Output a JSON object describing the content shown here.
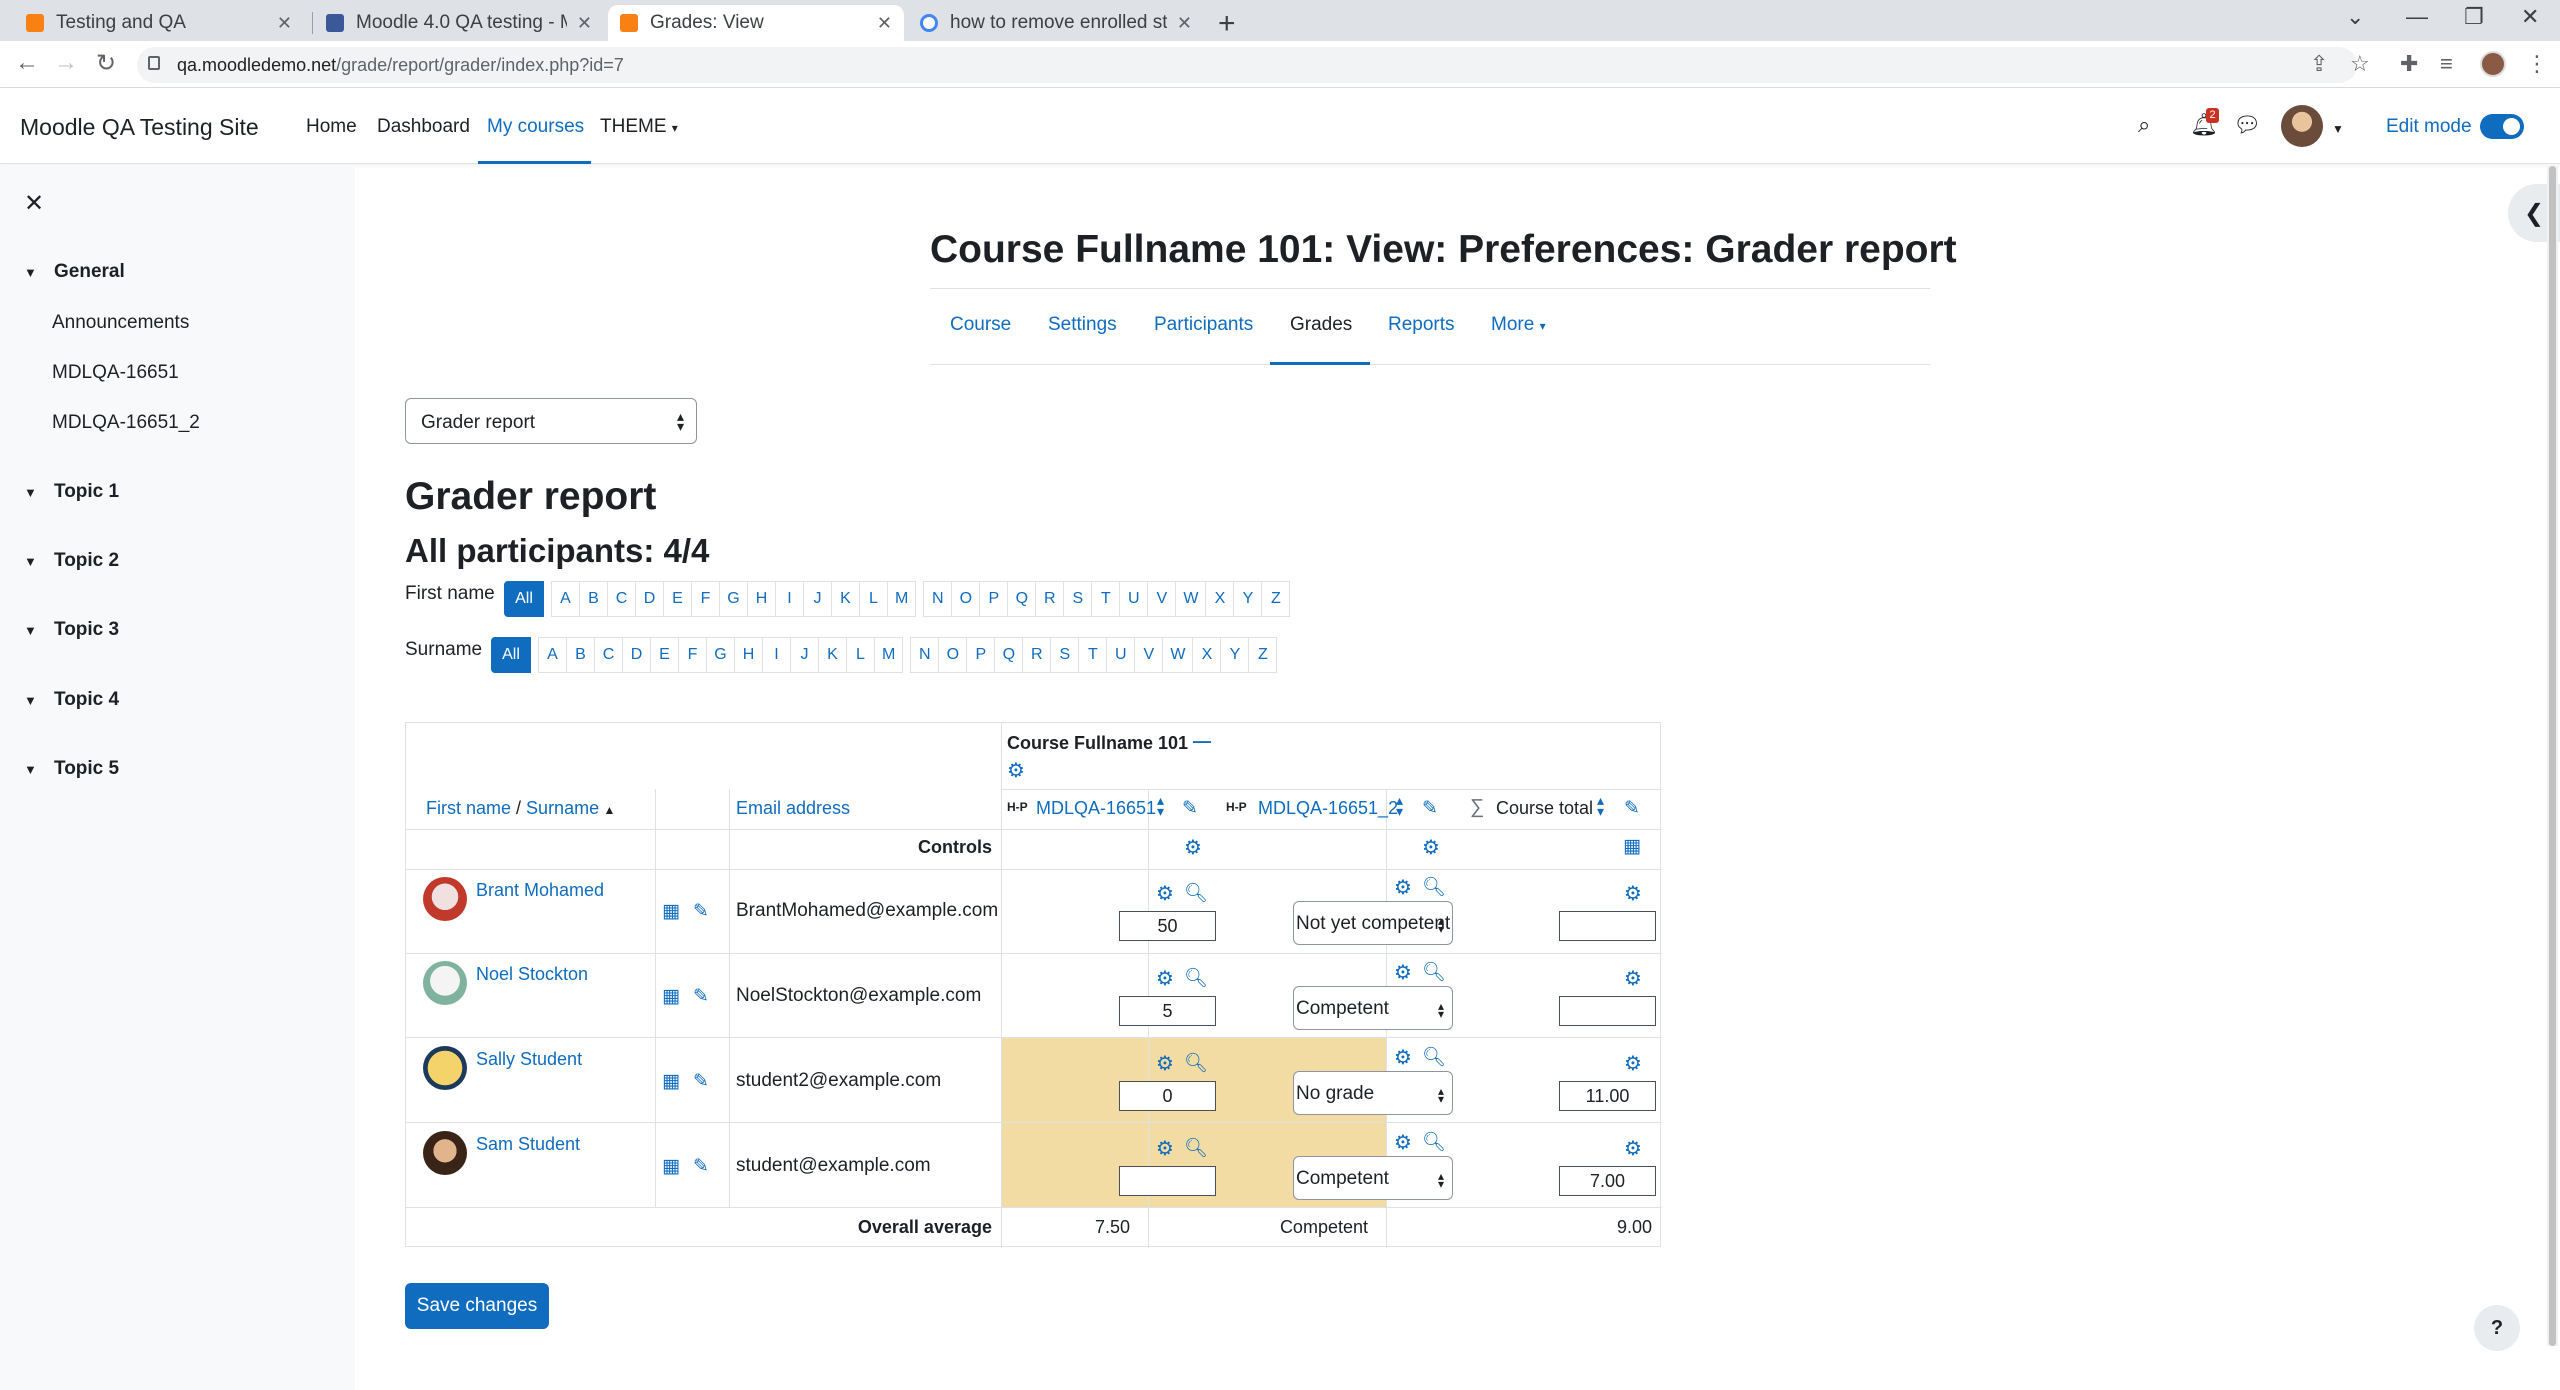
{
  "browser": {
    "tabs": [
      {
        "title": "Testing and QA",
        "color": "#f98012"
      },
      {
        "title": "Moodle 4.0 QA testing - Moodle",
        "color": "#3b5998"
      },
      {
        "title": "Grades: View",
        "color": "#f98012"
      },
      {
        "title": "how to remove enrolled students",
        "color": "#4285f4"
      }
    ],
    "url_host": "qa.moodledemo.net",
    "url_path": "/grade/report/grader/index.php?id=7"
  },
  "navbar": {
    "site_name": "Moodle QA Testing Site",
    "links": [
      "Home",
      "Dashboard",
      "My courses",
      "THEME"
    ],
    "notification_count": "2",
    "edit_mode_label": "Edit mode"
  },
  "drawer": {
    "sections": [
      {
        "title": "General",
        "items": [
          "Announcements",
          "MDLQA-16651",
          "MDLQA-16651_2"
        ]
      },
      {
        "title": "Topic 1"
      },
      {
        "title": "Topic 2"
      },
      {
        "title": "Topic 3"
      },
      {
        "title": "Topic 4"
      },
      {
        "title": "Topic 5"
      }
    ]
  },
  "page": {
    "title": "Course Fullname 101: View: Preferences: Grader report",
    "secondary_nav": [
      "Course",
      "Settings",
      "Participants",
      "Grades",
      "Reports",
      "More"
    ],
    "report_select": "Grader report",
    "heading": "Grader report",
    "participants": "All participants: 4/4"
  },
  "initials": {
    "firstname_label": "First name",
    "surname_label": "Surname",
    "all_label": "All",
    "letters": [
      "A",
      "B",
      "C",
      "D",
      "E",
      "F",
      "G",
      "H",
      "I",
      "J",
      "K",
      "L",
      "M",
      "N",
      "O",
      "P",
      "Q",
      "R",
      "S",
      "T",
      "U",
      "V",
      "W",
      "X",
      "Y",
      "Z"
    ]
  },
  "grader": {
    "course_name": "Course Fullname 101",
    "col_firstname": "First name",
    "col_sep": " / ",
    "col_surname": "Surname",
    "col_email": "Email address",
    "items": [
      "MDLQA-16651",
      "MDLQA-16651_2",
      "Course total"
    ],
    "item_icons": [
      "H-P",
      "H-P",
      "∑"
    ],
    "controls_label": "Controls",
    "rows": [
      {
        "name": "Brant Mohamed",
        "email": "BrantMohamed@example.com",
        "grade1": "50",
        "grade2": "Not yet competent",
        "total": "",
        "overridden": false
      },
      {
        "name": "Noel Stockton",
        "email": "NoelStockton@example.com",
        "grade1": "5",
        "grade2": "Competent",
        "total": "",
        "overridden": false
      },
      {
        "name": "Sally Student",
        "email": "student2@example.com",
        "grade1": "0",
        "grade2": "No grade",
        "total": "11.00",
        "overridden": true
      },
      {
        "name": "Sam Student",
        "email": "student@example.com",
        "grade1": "",
        "grade2": "Competent",
        "total": "7.00",
        "overridden": true
      }
    ],
    "average_label": "Overall average",
    "averages": [
      "7.50",
      "Competent",
      "9.00"
    ],
    "override_color": "#f2dca4"
  },
  "actions": {
    "save_label": "Save changes",
    "help_label": "?"
  },
  "colors": {
    "primary": "#0f6cbf"
  }
}
